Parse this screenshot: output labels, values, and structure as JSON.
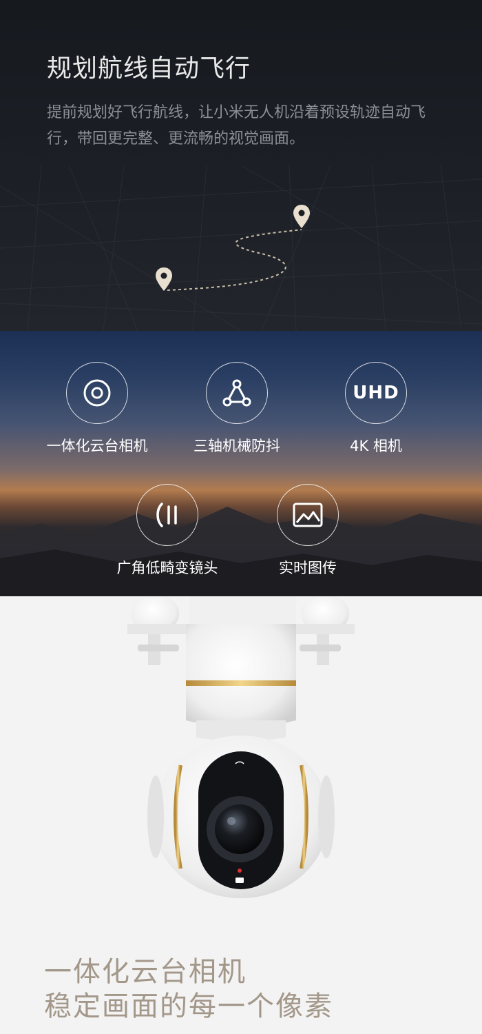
{
  "route_section": {
    "title": "规划航线自动飞行",
    "description": "提前规划好飞行航线，让小米无人机沿着预设轨迹自动飞行，带回更完整、更流畅的视觉画面。"
  },
  "features": [
    {
      "icon": "gimbal-icon",
      "label": "一体化云台相机"
    },
    {
      "icon": "triangle-nodes-icon",
      "label": "三轴机械防抖"
    },
    {
      "icon": "uhd-icon",
      "label": "4K 相机",
      "icon_text": "UHD"
    },
    {
      "icon": "wide-angle-icon",
      "label": "广角低畸变镜头"
    },
    {
      "icon": "image-icon",
      "label": "实时图传"
    }
  ],
  "camera_section": {
    "slogan_line1": "一体化云台相机",
    "slogan_line2": "稳定画面的每一个像素"
  },
  "colors": {
    "title_text": "#e9e9e9",
    "desc_text": "#8c8f96",
    "slogan_text": "#a3978a",
    "pin": "#e8dfcf"
  }
}
